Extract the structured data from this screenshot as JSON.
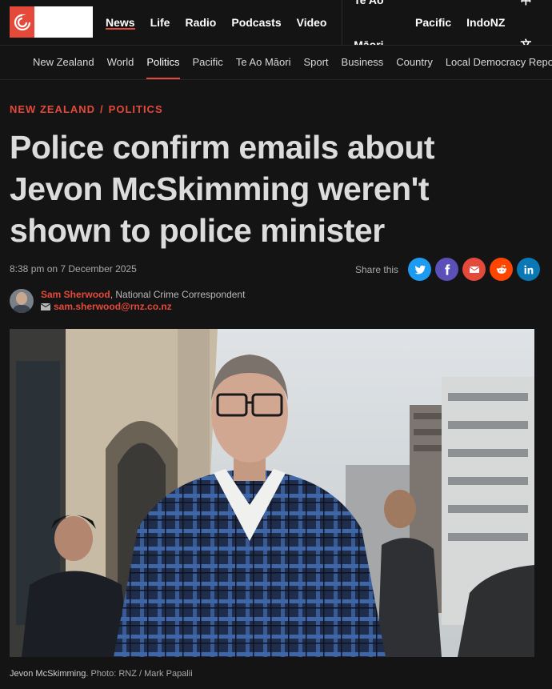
{
  "header": {
    "logo_icon": "rnz-logo-icon",
    "nav": [
      {
        "label": "News",
        "active": true
      },
      {
        "label": "Life",
        "active": false
      },
      {
        "label": "Radio",
        "active": false
      },
      {
        "label": "Podcasts",
        "active": false
      },
      {
        "label": "Video",
        "active": false
      },
      {
        "label": "Te Ao Māori",
        "active": false
      },
      {
        "label": "Pacific",
        "active": false
      },
      {
        "label": "IndoNZ",
        "active": false
      },
      {
        "label": "中文",
        "active": false
      }
    ]
  },
  "subnav": [
    {
      "label": "New Zealand",
      "active": false
    },
    {
      "label": "World",
      "active": false
    },
    {
      "label": "Politics",
      "active": true
    },
    {
      "label": "Pacific",
      "active": false
    },
    {
      "label": "Te Ao Māori",
      "active": false
    },
    {
      "label": "Sport",
      "active": false
    },
    {
      "label": "Business",
      "active": false
    },
    {
      "label": "Country",
      "active": false
    },
    {
      "label": "Local Democracy Reporting",
      "active": false
    }
  ],
  "article": {
    "kicker": [
      "NEW ZEALAND",
      "POLITICS"
    ],
    "headline": "Police confirm emails about Jevon McSkimming weren't shown to police minister",
    "dateline": "8:38 pm on 7 December 2025",
    "share_label": "Share this",
    "share_buttons": [
      {
        "icon": "twitter-icon",
        "color": "#1d9bf0"
      },
      {
        "icon": "facebook-icon",
        "color": "#5b4fb8"
      },
      {
        "icon": "email-icon",
        "color": "#e5493a"
      },
      {
        "icon": "reddit-icon",
        "color": "#ff4500"
      },
      {
        "icon": "linkedin-icon",
        "color": "#0a78b5"
      }
    ],
    "author": {
      "name": "Sam Sherwood",
      "role": ", National Crime Correspondent",
      "email": "sam.sherwood@rnz.co.nz"
    },
    "photo": {
      "caption": "Jevon McSkimming.",
      "credit": " Photo: RNZ / Mark Papalii"
    }
  },
  "colors": {
    "background": "#141414",
    "accent": "#e5493a",
    "headline": "#dcdcdc"
  }
}
